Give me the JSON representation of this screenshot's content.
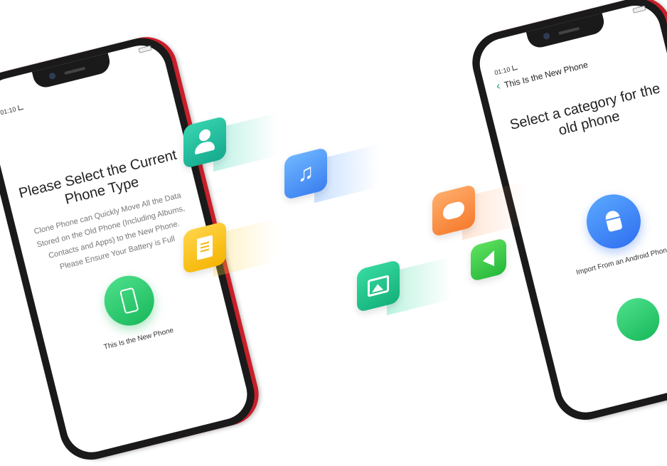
{
  "left_phone": {
    "status_time": "01:10",
    "title_line1": "Please Select the Current",
    "title_line2": "Phone Type",
    "description": "Clone Phone can Quickly Move All the Data Stored on the Old Phone (Including Albums, Contacts and Apps) to the New Phone. Please Ensure Your Battery is Full",
    "option_label": "This Is the New Phone",
    "option_icon": "phone-sparkle-icon"
  },
  "right_phone": {
    "status_time": "01:10",
    "topbar_title": "This Is the New Phone",
    "title_line1": "Select a category for the",
    "title_line2": "old phone",
    "option_label": "Import From an Android Phone",
    "option_icon": "android-icon"
  },
  "floating_tiles": [
    {
      "name": "contacts",
      "icon": "contacts-icon",
      "color": "#1fb99a"
    },
    {
      "name": "music",
      "icon": "music-note-icon",
      "color": "#3a7ff0"
    },
    {
      "name": "notes",
      "icon": "document-icon",
      "color": "#f5b400"
    },
    {
      "name": "gallery",
      "icon": "gallery-icon",
      "color": "#14b07a"
    },
    {
      "name": "messages",
      "icon": "message-bubble-icon",
      "color": "#f57a2c"
    },
    {
      "name": "play",
      "icon": "back-triangle-icon",
      "color": "#24b83a"
    }
  ],
  "accent_red": "#c8202a",
  "symbols": {
    "music": "♫",
    "chevron": "‹"
  }
}
